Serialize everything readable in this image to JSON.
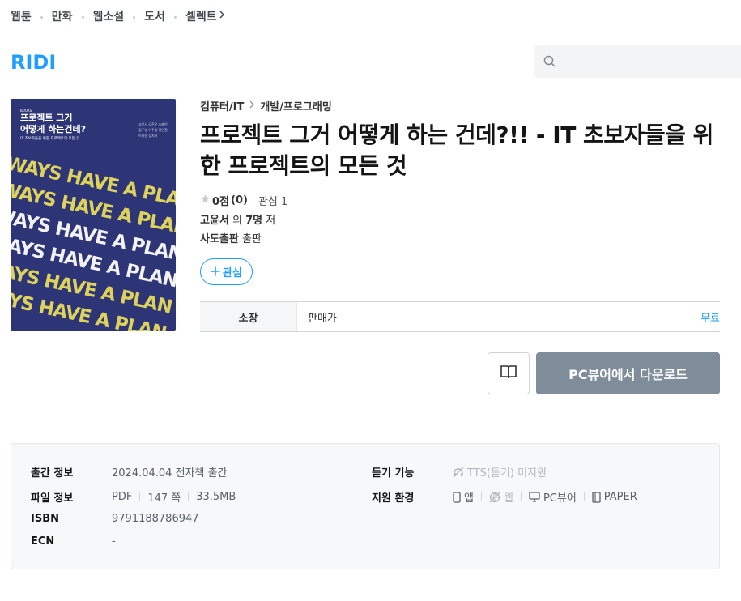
{
  "nav": {
    "items": [
      "웹툰",
      "만화",
      "웹소설",
      "도서",
      "셀렉트"
    ]
  },
  "header": {
    "logo": "RIDI",
    "search_placeholder": ""
  },
  "cover": {
    "series": "BOOKS",
    "title": "프로젝트 그거\n어떻게 하는건데?",
    "subtitle": "IT 초보자들을 위한 프로젝트의 모든 것",
    "authors": "고윤서 김준우 조혜인 김주영 이주형 정민철 이서원 강지혁",
    "slogan": "ALWAYS HAVE A PLAN"
  },
  "book": {
    "category": "컴퓨터/IT",
    "subcategory": "개발/프로그래밍",
    "title": "프로젝트 그거 어떻게 하는 건데?!! - IT 초보자들을 위한 프로젝트의 모든 것",
    "score": "0점",
    "score_count": "(0)",
    "interest": "관심 1",
    "author": "고윤서",
    "author_extra_pre": " 외 ",
    "author_count": "7명",
    "author_suffix": " 저",
    "publisher": "사도출판",
    "publisher_suffix": " 출판",
    "wish_label": "관심"
  },
  "price": {
    "label": "소장",
    "name": "판매가",
    "value": "무료"
  },
  "actions": {
    "download": "PC뷰어에서 다운로드"
  },
  "meta": {
    "publish_label": "출간 정보",
    "publish_value": "2024.04.04 전자책 출간",
    "file_label": "파일 정보",
    "file_format": "PDF",
    "file_pages": "147 쪽",
    "file_size": "33.5MB",
    "isbn_label": "ISBN",
    "isbn_value": "9791188786947",
    "ecn_label": "ECN",
    "ecn_value": "-",
    "listen_label": "듣기 기능",
    "listen_value": "TTS(듣기) 미지원",
    "env_label": "지원 환경",
    "env_app": "앱",
    "env_web": "웹",
    "env_pc": "PC뷰어",
    "env_paper": "PAPER"
  },
  "colors": {
    "brand": "#1e9eff",
    "cover_bg": "#2e3577",
    "cover_yellow": "#ddd25c",
    "button_gray": "#7f8c9a"
  }
}
